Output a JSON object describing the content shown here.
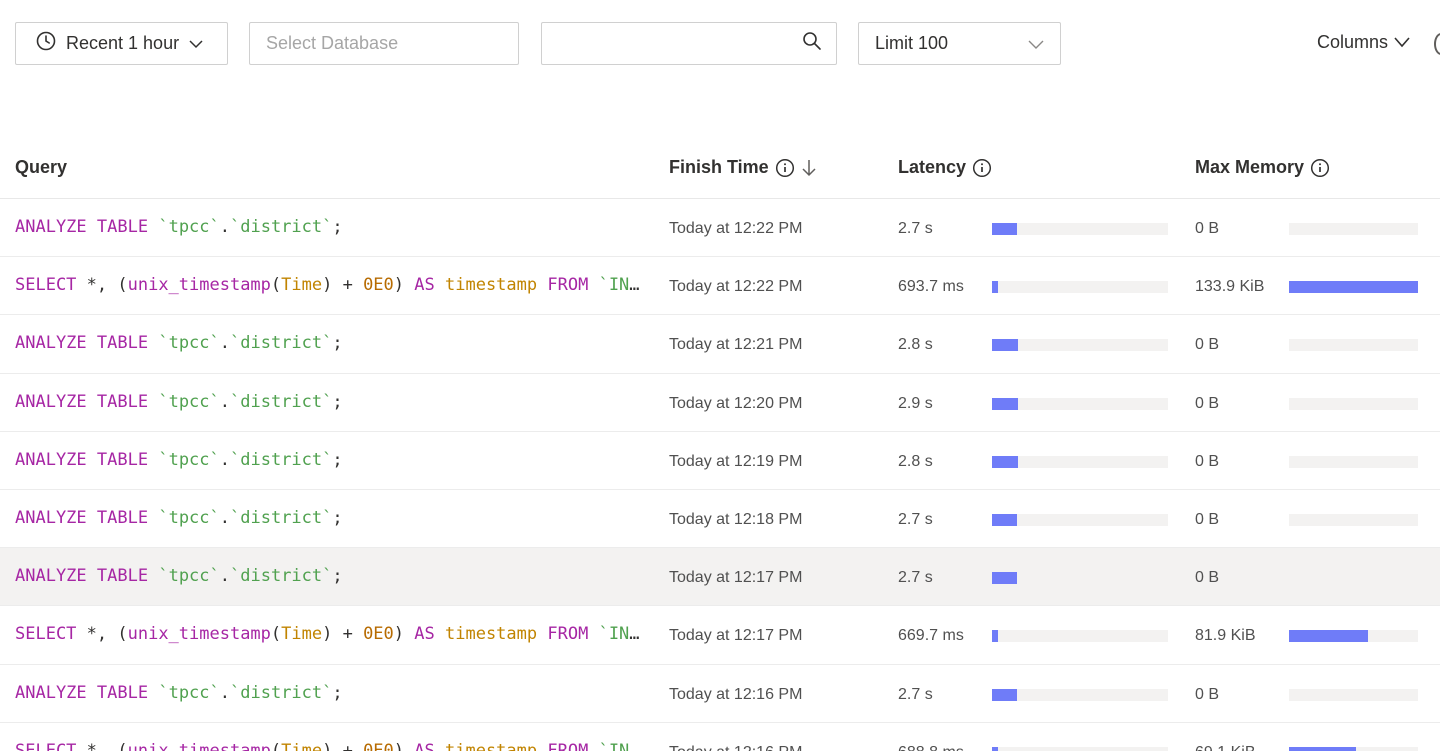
{
  "toolbar": {
    "time_range_label": "Recent 1 hour",
    "database_placeholder": "Select Database",
    "search_value": "",
    "limit_label": "Limit 100",
    "columns_label": "Columns"
  },
  "table": {
    "headers": {
      "query": "Query",
      "finish_time": "Finish Time",
      "latency": "Latency",
      "max_memory": "Max Memory"
    },
    "sort": {
      "column": "finish_time",
      "direction": "descending"
    },
    "highlight_color": "#6f7cf8",
    "rows": [
      {
        "query_tokens": [
          {
            "t": "ANALYZE",
            "c": "kw"
          },
          {
            "t": " ",
            "c": "punc"
          },
          {
            "t": "TABLE",
            "c": "kw"
          },
          {
            "t": " ",
            "c": "punc"
          },
          {
            "t": "`tpcc`",
            "c": "str"
          },
          {
            "t": ".",
            "c": "punc"
          },
          {
            "t": "`district`",
            "c": "str"
          },
          {
            "t": ";",
            "c": "punc"
          }
        ],
        "finish_time": "Today at 12:22 PM",
        "latency": "2.7 s",
        "latency_fraction": 0.14,
        "max_memory": "0 B",
        "memory_fraction": 0
      },
      {
        "query_tokens": [
          {
            "t": "SELECT",
            "c": "kw"
          },
          {
            "t": " *, (",
            "c": "punc"
          },
          {
            "t": "unix_timestamp",
            "c": "fn"
          },
          {
            "t": "(",
            "c": "punc"
          },
          {
            "t": "Time",
            "c": "alias"
          },
          {
            "t": ") + ",
            "c": "punc"
          },
          {
            "t": "0E0",
            "c": "num"
          },
          {
            "t": ") ",
            "c": "punc"
          },
          {
            "t": "AS",
            "c": "kw"
          },
          {
            "t": " ",
            "c": "punc"
          },
          {
            "t": "timestamp",
            "c": "alias"
          },
          {
            "t": " ",
            "c": "punc"
          },
          {
            "t": "FROM",
            "c": "kw"
          },
          {
            "t": " ",
            "c": "punc"
          },
          {
            "t": "`INFORMATION_SCHEMA`",
            "c": "str"
          }
        ],
        "finish_time": "Today at 12:22 PM",
        "latency": "693.7 ms",
        "latency_fraction": 0.035,
        "max_memory": "133.9 KiB",
        "memory_fraction": 1.0
      },
      {
        "query_tokens": [
          {
            "t": "ANALYZE",
            "c": "kw"
          },
          {
            "t": " ",
            "c": "punc"
          },
          {
            "t": "TABLE",
            "c": "kw"
          },
          {
            "t": " ",
            "c": "punc"
          },
          {
            "t": "`tpcc`",
            "c": "str"
          },
          {
            "t": ".",
            "c": "punc"
          },
          {
            "t": "`district`",
            "c": "str"
          },
          {
            "t": ";",
            "c": "punc"
          }
        ],
        "finish_time": "Today at 12:21 PM",
        "latency": "2.8 s",
        "latency_fraction": 0.145,
        "max_memory": "0 B",
        "memory_fraction": 0
      },
      {
        "query_tokens": [
          {
            "t": "ANALYZE",
            "c": "kw"
          },
          {
            "t": " ",
            "c": "punc"
          },
          {
            "t": "TABLE",
            "c": "kw"
          },
          {
            "t": " ",
            "c": "punc"
          },
          {
            "t": "`tpcc`",
            "c": "str"
          },
          {
            "t": ".",
            "c": "punc"
          },
          {
            "t": "`district`",
            "c": "str"
          },
          {
            "t": ";",
            "c": "punc"
          }
        ],
        "finish_time": "Today at 12:20 PM",
        "latency": "2.9 s",
        "latency_fraction": 0.15,
        "max_memory": "0 B",
        "memory_fraction": 0
      },
      {
        "query_tokens": [
          {
            "t": "ANALYZE",
            "c": "kw"
          },
          {
            "t": " ",
            "c": "punc"
          },
          {
            "t": "TABLE",
            "c": "kw"
          },
          {
            "t": " ",
            "c": "punc"
          },
          {
            "t": "`tpcc`",
            "c": "str"
          },
          {
            "t": ".",
            "c": "punc"
          },
          {
            "t": "`district`",
            "c": "str"
          },
          {
            "t": ";",
            "c": "punc"
          }
        ],
        "finish_time": "Today at 12:19 PM",
        "latency": "2.8 s",
        "latency_fraction": 0.145,
        "max_memory": "0 B",
        "memory_fraction": 0
      },
      {
        "query_tokens": [
          {
            "t": "ANALYZE",
            "c": "kw"
          },
          {
            "t": " ",
            "c": "punc"
          },
          {
            "t": "TABLE",
            "c": "kw"
          },
          {
            "t": " ",
            "c": "punc"
          },
          {
            "t": "`tpcc`",
            "c": "str"
          },
          {
            "t": ".",
            "c": "punc"
          },
          {
            "t": "`district`",
            "c": "str"
          },
          {
            "t": ";",
            "c": "punc"
          }
        ],
        "finish_time": "Today at 12:18 PM",
        "latency": "2.7 s",
        "latency_fraction": 0.14,
        "max_memory": "0 B",
        "memory_fraction": 0
      },
      {
        "query_tokens": [
          {
            "t": "ANALYZE",
            "c": "kw"
          },
          {
            "t": " ",
            "c": "punc"
          },
          {
            "t": "TABLE",
            "c": "kw"
          },
          {
            "t": " ",
            "c": "punc"
          },
          {
            "t": "`tpcc`",
            "c": "str"
          },
          {
            "t": ".",
            "c": "punc"
          },
          {
            "t": "`district`",
            "c": "str"
          },
          {
            "t": ";",
            "c": "punc"
          }
        ],
        "finish_time": "Today at 12:17 PM",
        "latency": "2.7 s",
        "latency_fraction": 0.14,
        "max_memory": "0 B",
        "memory_fraction": 0,
        "hovered": true
      },
      {
        "query_tokens": [
          {
            "t": "SELECT",
            "c": "kw"
          },
          {
            "t": " *, (",
            "c": "punc"
          },
          {
            "t": "unix_timestamp",
            "c": "fn"
          },
          {
            "t": "(",
            "c": "punc"
          },
          {
            "t": "Time",
            "c": "alias"
          },
          {
            "t": ") + ",
            "c": "punc"
          },
          {
            "t": "0E0",
            "c": "num"
          },
          {
            "t": ") ",
            "c": "punc"
          },
          {
            "t": "AS",
            "c": "kw"
          },
          {
            "t": " ",
            "c": "punc"
          },
          {
            "t": "timestamp",
            "c": "alias"
          },
          {
            "t": " ",
            "c": "punc"
          },
          {
            "t": "FROM",
            "c": "kw"
          },
          {
            "t": " ",
            "c": "punc"
          },
          {
            "t": "`INFORMATION_SCHEMA`",
            "c": "str"
          }
        ],
        "finish_time": "Today at 12:17 PM",
        "latency": "669.7 ms",
        "latency_fraction": 0.034,
        "max_memory": "81.9 KiB",
        "memory_fraction": 0.61
      },
      {
        "query_tokens": [
          {
            "t": "ANALYZE",
            "c": "kw"
          },
          {
            "t": " ",
            "c": "punc"
          },
          {
            "t": "TABLE",
            "c": "kw"
          },
          {
            "t": " ",
            "c": "punc"
          },
          {
            "t": "`tpcc`",
            "c": "str"
          },
          {
            "t": ".",
            "c": "punc"
          },
          {
            "t": "`district`",
            "c": "str"
          },
          {
            "t": ";",
            "c": "punc"
          }
        ],
        "finish_time": "Today at 12:16 PM",
        "latency": "2.7 s",
        "latency_fraction": 0.14,
        "max_memory": "0 B",
        "memory_fraction": 0
      },
      {
        "query_tokens": [
          {
            "t": "SELECT",
            "c": "kw"
          },
          {
            "t": " *, (",
            "c": "punc"
          },
          {
            "t": "unix_timestamp",
            "c": "fn"
          },
          {
            "t": "(",
            "c": "punc"
          },
          {
            "t": "Time",
            "c": "alias"
          },
          {
            "t": ") + ",
            "c": "punc"
          },
          {
            "t": "0E0",
            "c": "num"
          },
          {
            "t": ") ",
            "c": "punc"
          },
          {
            "t": "AS",
            "c": "kw"
          },
          {
            "t": " ",
            "c": "punc"
          },
          {
            "t": "timestamp",
            "c": "alias"
          },
          {
            "t": " ",
            "c": "punc"
          },
          {
            "t": "FROM",
            "c": "kw"
          },
          {
            "t": " ",
            "c": "punc"
          },
          {
            "t": "`INFORMATION_SCHEMA`",
            "c": "str"
          }
        ],
        "finish_time": "Today at 12:16 PM",
        "latency": "688.8 ms",
        "latency_fraction": 0.035,
        "max_memory": "69.1 KiB",
        "memory_fraction": 0.52
      }
    ]
  }
}
